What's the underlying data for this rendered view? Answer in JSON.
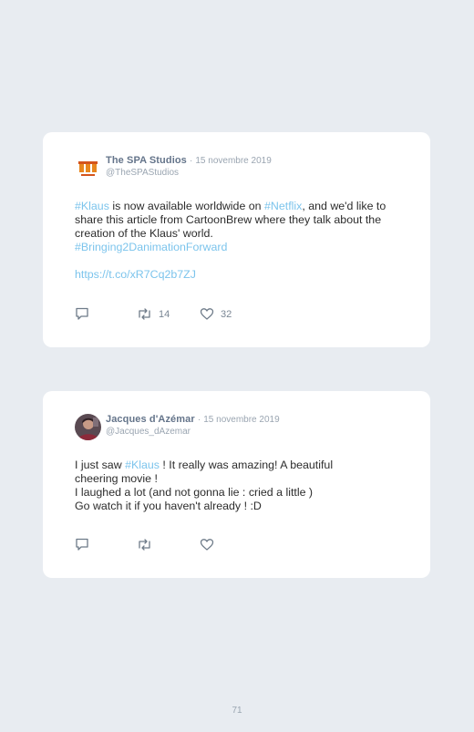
{
  "tweets": [
    {
      "display_name": "The SPA Studios",
      "date": "15 novembre 2019",
      "handle": "@TheSPAStudios",
      "body": {
        "tag1": "#Klaus",
        "t1": " is now available worldwide on ",
        "tag2": "#Netflix",
        "t2": ", and we'd like to share this article from CartoonBrew where they talk about the creation of the Klaus' world.",
        "tag3": "#Bringing2DanimationForward",
        "link": "https://t.co/xR7Cq2b7ZJ"
      },
      "retweets": "14",
      "likes": "32"
    },
    {
      "display_name": "Jacques d'Azémar",
      "date": "15 novembre 2019",
      "handle": "@Jacques_dAzemar",
      "body": {
        "t1": "I just saw ",
        "tag1": "#Klaus",
        "t2": " ! It really was amazing! A beautiful cheering movie !",
        "line2": "I laughed a lot (and not gonna lie : cried a little )",
        "line3": "Go watch it if you haven't already ! :D"
      }
    }
  ],
  "separator": "·",
  "page_number": "71",
  "icons": {
    "reply": "reply-icon",
    "retweet": "retweet-icon",
    "like": "heart-icon",
    "avatar1": "spa-studios-logo",
    "avatar2": "user-avatar"
  },
  "colors": {
    "background": "#e8ecf1",
    "card": "#ffffff",
    "hashtag": "#7cc4ec",
    "name": "#64748a",
    "muted": "#9aa5b1"
  }
}
